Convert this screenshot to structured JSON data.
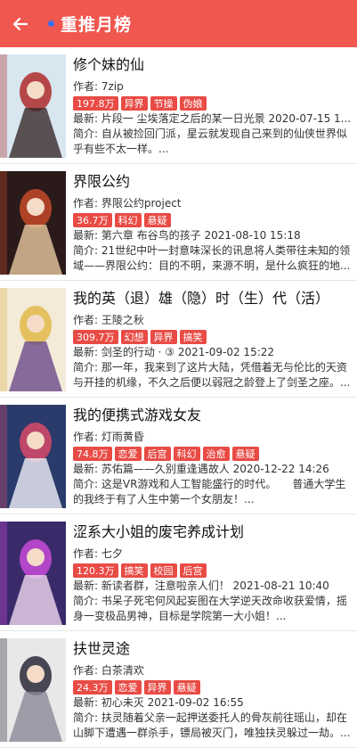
{
  "header": {
    "title": "重推月榜"
  },
  "books": [
    {
      "title": "修个妹的仙",
      "author_prefix": "作者: ",
      "author": "7zip",
      "count": "197.8万",
      "tags": [
        "异界",
        "节操",
        "伪娘"
      ],
      "latest_prefix": "最新: ",
      "latest": "片段一 尘埃落定之后的某一日光景 2020-07-15 1...",
      "intro_prefix": "简介: ",
      "intro": "自从被捡回门派，星云就发现自己来到的仙侠世界似乎有些不太一样。...",
      "cover_colors": [
        "#d8e6f0",
        "#b02a2a",
        "#3a2a2a"
      ]
    },
    {
      "title": "界限公约",
      "author_prefix": "作者: ",
      "author": "界限公约project",
      "count": "36.7万",
      "tags": [
        "科幻",
        "悬疑"
      ],
      "latest_prefix": "最新: ",
      "latest": "第六章 布谷鸟的孩子 2021-08-10 15:18",
      "intro_prefix": "简介: ",
      "intro": "21世纪中叶一封意味深长的讯息将人类带往未知的领域——界限公约：目的不明，来源不明，是什么疯狂的地...",
      "cover_colors": [
        "#2a1a1a",
        "#c64a2a",
        "#e8c8a0"
      ]
    },
    {
      "title": "我的英（退）雄（隐）时（生）代（活）",
      "author_prefix": "作者: ",
      "author": "王陵之秋",
      "count": "309.7万",
      "tags": [
        "幻想",
        "异界",
        "搞笑"
      ],
      "latest_prefix": "最新: ",
      "latest": "剑圣的行动 · ③ 2021-09-02 15:22",
      "intro_prefix": "简介: ",
      "intro": "那一年，我来到了这片大陆，凭借着无与伦比的天资与开挂的机缘，不久之后便以弱冠之龄登上了剑圣之座。...",
      "cover_colors": [
        "#f3ead8",
        "#e0b84a",
        "#6a4a8a"
      ]
    },
    {
      "title": "我的便携式游戏女友",
      "author_prefix": "作者: ",
      "author": "灯雨黄昏",
      "count": "74.8万",
      "tags": [
        "恋爱",
        "后宫",
        "科幻",
        "治愈",
        "悬疑"
      ],
      "latest_prefix": "最新: ",
      "latest": "苏佑篇——久别重逢遇故人 2020-12-22 14:26",
      "intro_prefix": "简介: ",
      "intro": "这是VR游戏和人工智能盛行的时代。　　普通大学生的我终于有了人生中第一个女朋友！...",
      "cover_colors": [
        "#2a3a6a",
        "#d84a6a",
        "#f0f0f8"
      ]
    },
    {
      "title": "涩系大小姐的废宅养成计划",
      "author_prefix": "作者: ",
      "author": "七夕",
      "count": "120.3万",
      "tags": [
        "搞笑",
        "校园",
        "后宫"
      ],
      "latest_prefix": "最新: ",
      "latest": "新读者群，注意啦亲人们！ 2021-08-21 10:40",
      "intro_prefix": "简介: ",
      "intro": "书呆子死宅何风起妄图在大学逆天改命收获爱情，摇身一变极品男神，目标是学院第一大小姐！...",
      "cover_colors": [
        "#3a2a6a",
        "#c84ad8",
        "#f0d8f0"
      ]
    },
    {
      "title": "扶世灵途",
      "author_prefix": "作者: ",
      "author": "白茶清欢",
      "count": "24.3万",
      "tags": [
        "恋爱",
        "异界",
        "悬疑"
      ],
      "latest_prefix": "最新: ",
      "latest": "初心未灭 2021-09-02 16:55",
      "intro_prefix": "简介: ",
      "intro": "扶灵随着父亲一起押送委托人的骨灰前往瑶山，却在山脚下遭遇一群杀手，镖局被灭门，唯独扶灵躲过一劫。...",
      "cover_colors": [
        "#e8e8e8",
        "#2a2a3a",
        "#8a8a9a"
      ]
    }
  ]
}
